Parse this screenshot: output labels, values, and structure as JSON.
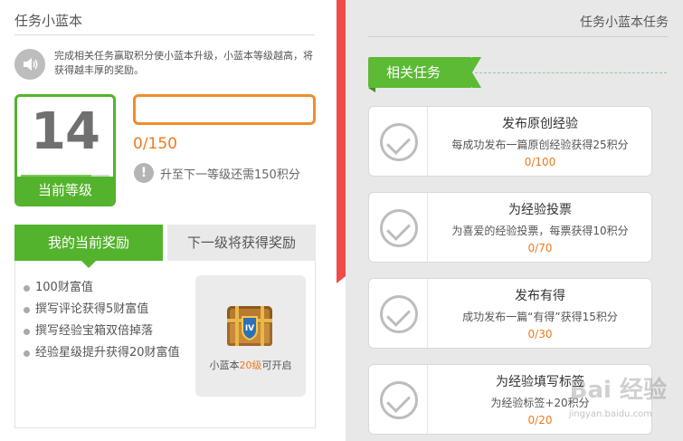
{
  "left": {
    "title": "任务小蓝本",
    "intro": "完成相关任务赢取积分使小蓝本升级，小蓝本等级越高，将获得越丰厚的奖励。",
    "level_value": "14",
    "level_label": "当前等级",
    "level_progress_fraction": 0.8,
    "progress_text": "0/150",
    "need_text": "升至下一等级还需150积分",
    "tabs": {
      "current": "我的当前奖励",
      "next": "下一级将获得奖励"
    },
    "rewards": [
      "100财富值",
      "撰写评论获得5财富值",
      "撰写经验宝箱双倍掉落",
      "经验星级提升获得20财富值"
    ],
    "chest": {
      "prefix": "小蓝本",
      "level": "20级",
      "suffix": "可开启",
      "badge": "IV"
    }
  },
  "right": {
    "title": "任务小蓝本任务",
    "ribbon": "相关任务",
    "tasks": [
      {
        "name": "发布原创经验",
        "desc": "每成功发布一篇原创经验获得25积分",
        "progress": "0/100"
      },
      {
        "name": "为经验投票",
        "desc": "为喜爱的经验投票，每票获得10积分",
        "progress": "0/70"
      },
      {
        "name": "发布有得",
        "desc": "成功发布一篇“有得”获得15积分",
        "progress": "0/30"
      },
      {
        "name": "为经验填写标签",
        "desc": "为经验标签+20积分",
        "progress": "0/20"
      }
    ]
  },
  "watermark": {
    "main": "Bai 经验",
    "sub": "jingyan.baidu.com"
  },
  "colors": {
    "green": "#54b32c",
    "orange": "#ef7a1c",
    "red": "#f04b4b",
    "gray_bg": "#e8e8e8"
  }
}
